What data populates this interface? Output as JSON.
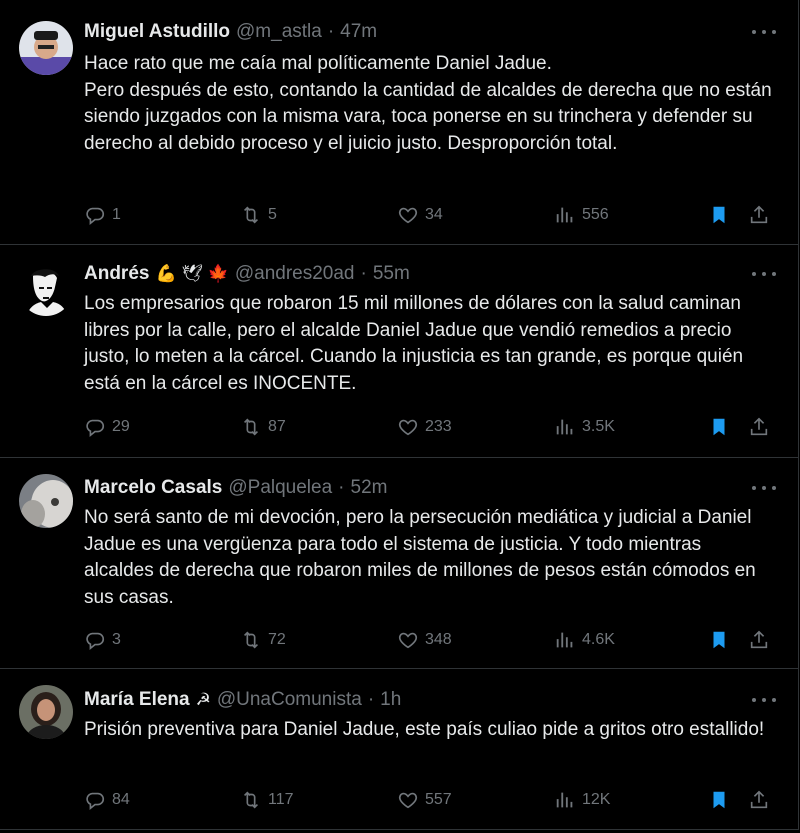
{
  "tweets": [
    {
      "name": "Miguel Astudillo",
      "emoji": "",
      "handle": "@m_astla",
      "time": "47m",
      "text": "Hace rato que me caía mal políticamente Daniel Jadue.\nPero después de esto, contando la cantidad de alcaldes de derecha que no están siendo juzgados con la misma vara, toca ponerse en su trinchera y defender su derecho al debido proceso y el juicio justo. Desproporción total.",
      "replies": "1",
      "retweets": "5",
      "likes": "34",
      "views": "556"
    },
    {
      "name": "Andrés",
      "emoji": "💪 🕊 🍁",
      "handle": "@andres20ad",
      "time": "55m",
      "text": "Los empresarios que robaron 15 mil millones de dólares con la salud caminan libres por la calle, pero el alcalde Daniel Jadue que vendió remedios a precio justo, lo meten a la cárcel. Cuando la injusticia es tan grande, es porque quién está en la cárcel es INOCENTE.",
      "replies": "29",
      "retweets": "87",
      "likes": "233",
      "views": "3.5K"
    },
    {
      "name": "Marcelo Casals",
      "emoji": "",
      "handle": "@Palquelea",
      "time": "52m",
      "text": "No será santo de mi devoción, pero la persecución mediática y judicial a Daniel Jadue es una vergüenza para todo el sistema de justicia. Y todo mientras alcaldes de derecha que robaron miles de millones de pesos están cómodos en sus casas.",
      "replies": "3",
      "retweets": "72",
      "likes": "348",
      "views": "4.6K"
    },
    {
      "name": "María Elena",
      "emoji": "☭",
      "handle": "@UnaComunista",
      "time": "1h",
      "text": "Prisión preventiva para Daniel Jadue, este país culiao pide a gritos otro estallido!",
      "replies": "84",
      "retweets": "117",
      "likes": "557",
      "views": "12K"
    }
  ],
  "icons": {
    "reply": "reply-icon",
    "retweet": "retweet-icon",
    "like": "heart-icon",
    "views": "views-icon",
    "bookmark": "bookmark-icon",
    "share": "share-icon",
    "more": "more-icon"
  },
  "colors": {
    "background": "#000000",
    "text": "#e7e9ea",
    "muted": "#71767b",
    "accent": "#1d9bf0",
    "border": "#2f3336"
  }
}
